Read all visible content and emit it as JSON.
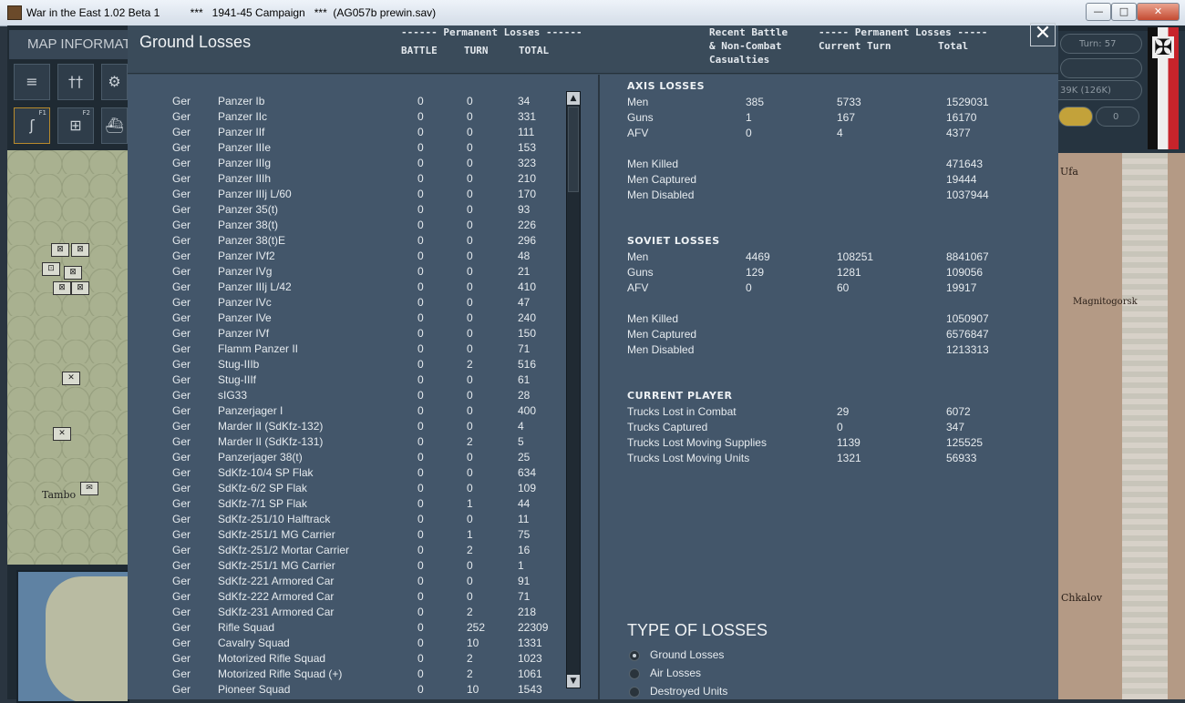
{
  "window": {
    "title": "War in the East 1.02 Beta 1          ***   1941-45 Campaign   ***  (AG057b prewin.sav)",
    "minimize": "—",
    "maximize": "□",
    "close": "✕"
  },
  "background": {
    "map_information": "MAP INFORMATION",
    "tool_icons": [
      "tank-icon",
      "infantry-icon",
      "gear-icon",
      "road-icon",
      "rail-icon",
      "ship-icon"
    ],
    "tools": [
      "≡",
      "††",
      "⚙",
      "ʃ",
      "⊞",
      "⛴"
    ],
    "f1": "F1",
    "f2": "F2",
    "turn": "Turn: 57",
    "supply": "39K (126K)",
    "zero": "0",
    "map_cities": {
      "tambo": "Tambo",
      "ufa": "Ufa",
      "magnitogorsk": "Magnitogorsk",
      "chkalov": "Chkalov"
    }
  },
  "dialog": {
    "title": "Ground Losses",
    "left_group_header": "------ Permanent Losses ------",
    "col_battle": "BATTLE",
    "col_turn": "TURN",
    "col_total": "TOTAL",
    "recent_header": "Recent Battle\n& Non-Combat\nCasualties",
    "right_group_header": "----- Permanent Losses -----",
    "col_current_turn": "Current Turn",
    "col_total_right": "Total",
    "close": "✕"
  },
  "losses": [
    {
      "nation": "Ger",
      "unit": "Panzer Ib",
      "battle": "0",
      "turn": "0",
      "total": "34"
    },
    {
      "nation": "Ger",
      "unit": "Panzer IIc",
      "battle": "0",
      "turn": "0",
      "total": "331"
    },
    {
      "nation": "Ger",
      "unit": "Panzer IIf",
      "battle": "0",
      "turn": "0",
      "total": "111"
    },
    {
      "nation": "Ger",
      "unit": "Panzer IIIe",
      "battle": "0",
      "turn": "0",
      "total": "153"
    },
    {
      "nation": "Ger",
      "unit": "Panzer IIIg",
      "battle": "0",
      "turn": "0",
      "total": "323"
    },
    {
      "nation": "Ger",
      "unit": "Panzer IIIh",
      "battle": "0",
      "turn": "0",
      "total": "210"
    },
    {
      "nation": "Ger",
      "unit": "Panzer IIIj L/60",
      "battle": "0",
      "turn": "0",
      "total": "170"
    },
    {
      "nation": "Ger",
      "unit": "Panzer 35(t)",
      "battle": "0",
      "turn": "0",
      "total": "93"
    },
    {
      "nation": "Ger",
      "unit": "Panzer 38(t)",
      "battle": "0",
      "turn": "0",
      "total": "226"
    },
    {
      "nation": "Ger",
      "unit": "Panzer 38(t)E",
      "battle": "0",
      "turn": "0",
      "total": "296"
    },
    {
      "nation": "Ger",
      "unit": "Panzer IVf2",
      "battle": "0",
      "turn": "0",
      "total": "48"
    },
    {
      "nation": "Ger",
      "unit": "Panzer IVg",
      "battle": "0",
      "turn": "0",
      "total": "21"
    },
    {
      "nation": "Ger",
      "unit": "Panzer IIIj L/42",
      "battle": "0",
      "turn": "0",
      "total": "410"
    },
    {
      "nation": "Ger",
      "unit": "Panzer IVc",
      "battle": "0",
      "turn": "0",
      "total": "47"
    },
    {
      "nation": "Ger",
      "unit": "Panzer IVe",
      "battle": "0",
      "turn": "0",
      "total": "240"
    },
    {
      "nation": "Ger",
      "unit": "Panzer IVf",
      "battle": "0",
      "turn": "0",
      "total": "150"
    },
    {
      "nation": "Ger",
      "unit": "Flamm Panzer II",
      "battle": "0",
      "turn": "0",
      "total": "71"
    },
    {
      "nation": "Ger",
      "unit": "Stug-IIIb",
      "battle": "0",
      "turn": "2",
      "total": "516"
    },
    {
      "nation": "Ger",
      "unit": "Stug-IIIf",
      "battle": "0",
      "turn": "0",
      "total": "61"
    },
    {
      "nation": "Ger",
      "unit": "sIG33",
      "battle": "0",
      "turn": "0",
      "total": "28"
    },
    {
      "nation": "Ger",
      "unit": "Panzerjager I",
      "battle": "0",
      "turn": "0",
      "total": "400"
    },
    {
      "nation": "Ger",
      "unit": "Marder II (SdKfz-132)",
      "battle": "0",
      "turn": "0",
      "total": "4"
    },
    {
      "nation": "Ger",
      "unit": "Marder II (SdKfz-131)",
      "battle": "0",
      "turn": "2",
      "total": "5"
    },
    {
      "nation": "Ger",
      "unit": "Panzerjager 38(t)",
      "battle": "0",
      "turn": "0",
      "total": "25"
    },
    {
      "nation": "Ger",
      "unit": "SdKfz-10/4 SP Flak",
      "battle": "0",
      "turn": "0",
      "total": "634"
    },
    {
      "nation": "Ger",
      "unit": "SdKfz-6/2 SP Flak",
      "battle": "0",
      "turn": "0",
      "total": "109"
    },
    {
      "nation": "Ger",
      "unit": "SdKfz-7/1 SP Flak",
      "battle": "0",
      "turn": "1",
      "total": "44"
    },
    {
      "nation": "Ger",
      "unit": "SdKfz-251/10 Halftrack",
      "battle": "0",
      "turn": "0",
      "total": "11"
    },
    {
      "nation": "Ger",
      "unit": "SdKfz-251/1 MG Carrier",
      "battle": "0",
      "turn": "1",
      "total": "75"
    },
    {
      "nation": "Ger",
      "unit": "SdKfz-251/2 Mortar Carrier",
      "battle": "0",
      "turn": "2",
      "total": "16"
    },
    {
      "nation": "Ger",
      "unit": "SdKfz-251/1 MG Carrier",
      "battle": "0",
      "turn": "0",
      "total": "1"
    },
    {
      "nation": "Ger",
      "unit": "SdKfz-221 Armored Car",
      "battle": "0",
      "turn": "0",
      "total": "91"
    },
    {
      "nation": "Ger",
      "unit": "SdKfz-222 Armored Car",
      "battle": "0",
      "turn": "0",
      "total": "71"
    },
    {
      "nation": "Ger",
      "unit": "SdKfz-231 Armored Car",
      "battle": "0",
      "turn": "2",
      "total": "218"
    },
    {
      "nation": "Ger",
      "unit": "Rifle Squad",
      "battle": "0",
      "turn": "252",
      "total": "22309"
    },
    {
      "nation": "Ger",
      "unit": "Cavalry Squad",
      "battle": "0",
      "turn": "10",
      "total": "1331"
    },
    {
      "nation": "Ger",
      "unit": "Motorized Rifle Squad",
      "battle": "0",
      "turn": "2",
      "total": "1023"
    },
    {
      "nation": "Ger",
      "unit": "Motorized Rifle Squad (+)",
      "battle": "0",
      "turn": "2",
      "total": "1061"
    },
    {
      "nation": "Ger",
      "unit": "Pioneer Squad",
      "battle": "0",
      "turn": "10",
      "total": "1543"
    }
  ],
  "scrollbar": {
    "up": "▲",
    "down": "▼"
  },
  "axis": {
    "title": "AXIS LOSSES",
    "rows": [
      {
        "label": "Men",
        "recent": "385",
        "current": "5733",
        "total": "1529031"
      },
      {
        "label": "Guns",
        "recent": "1",
        "current": "167",
        "total": "16170"
      },
      {
        "label": "AFV",
        "recent": "0",
        "current": "4",
        "total": "4377"
      },
      {
        "label": "Men Killed",
        "recent": "",
        "current": "",
        "total": "471643"
      },
      {
        "label": "Men Captured",
        "recent": "",
        "current": "",
        "total": "19444"
      },
      {
        "label": "Men Disabled",
        "recent": "",
        "current": "",
        "total": "1037944"
      }
    ]
  },
  "soviet": {
    "title": "SOVIET LOSSES",
    "rows": [
      {
        "label": "Men",
        "recent": "4469",
        "current": "108251",
        "total": "8841067"
      },
      {
        "label": "Guns",
        "recent": "129",
        "current": "1281",
        "total": "109056"
      },
      {
        "label": "AFV",
        "recent": "0",
        "current": "60",
        "total": "19917"
      },
      {
        "label": "Men Killed",
        "recent": "",
        "current": "",
        "total": "1050907"
      },
      {
        "label": "Men Captured",
        "recent": "",
        "current": "",
        "total": "6576847"
      },
      {
        "label": "Men Disabled",
        "recent": "",
        "current": "",
        "total": "1213313"
      }
    ]
  },
  "current_player": {
    "title": "CURRENT PLAYER",
    "rows": [
      {
        "label": "Trucks Lost in Combat",
        "current": "29",
        "total": "6072"
      },
      {
        "label": "Trucks Captured",
        "current": "0",
        "total": "347"
      },
      {
        "label": "Trucks Lost Moving Supplies",
        "current": "1139",
        "total": "125525"
      },
      {
        "label": "Trucks Lost Moving Units",
        "current": "1321",
        "total": "56933"
      }
    ]
  },
  "type_of_losses": {
    "title": "TYPE OF LOSSES",
    "options": [
      "Ground Losses",
      "Air Losses",
      "Destroyed Units"
    ],
    "selected": "Ground Losses"
  },
  "colors": {
    "dialog_bg": "#3a4b5a",
    "panel_bg": "#43566a",
    "text": "#e6ebef"
  }
}
